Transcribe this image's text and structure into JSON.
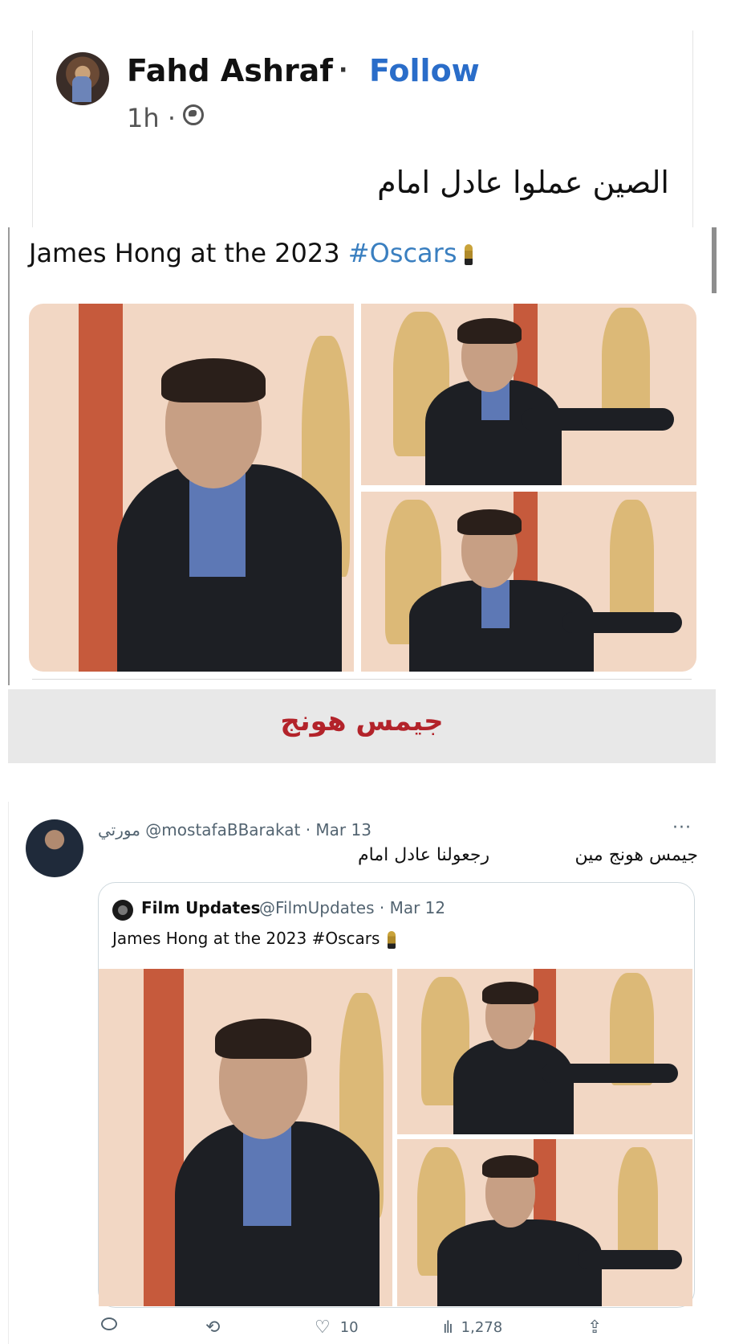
{
  "facebook_post": {
    "author": "Fahd Ashraf",
    "separator": "·",
    "follow_label": "Follow",
    "time": "1h ·",
    "body": "الصين عملوا عادل امام",
    "shared_tweet": {
      "text": "James Hong at the 2023",
      "hashtag": "#Oscars"
    }
  },
  "banner": {
    "text": "جيمس هونج"
  },
  "tweet": {
    "handle_line": "مورتي @mostafaBBarakat · Mar 13",
    "more": "···",
    "reply_part_a": "جيمس هونج مين",
    "reply_part_b": "رجعولنا عادل امام",
    "quoted": {
      "author": "Film Updates",
      "meta": "@FilmUpdates · Mar 12",
      "text": "James Hong at the 2023 #Oscars"
    },
    "actions": {
      "likes": "10",
      "views": "1,278"
    }
  },
  "icons": [
    "globe-icon",
    "trophy-icon",
    "reply-icon",
    "retweet-icon",
    "like-icon",
    "views-icon",
    "share-icon",
    "more-icon"
  ],
  "colors": {
    "follow_blue": "#2a6dc9",
    "hashtag_blue": "#3a7fc0",
    "banner_red": "#b3232a",
    "banner_bg": "#e8e8e8",
    "twitter_gray": "#536471"
  }
}
